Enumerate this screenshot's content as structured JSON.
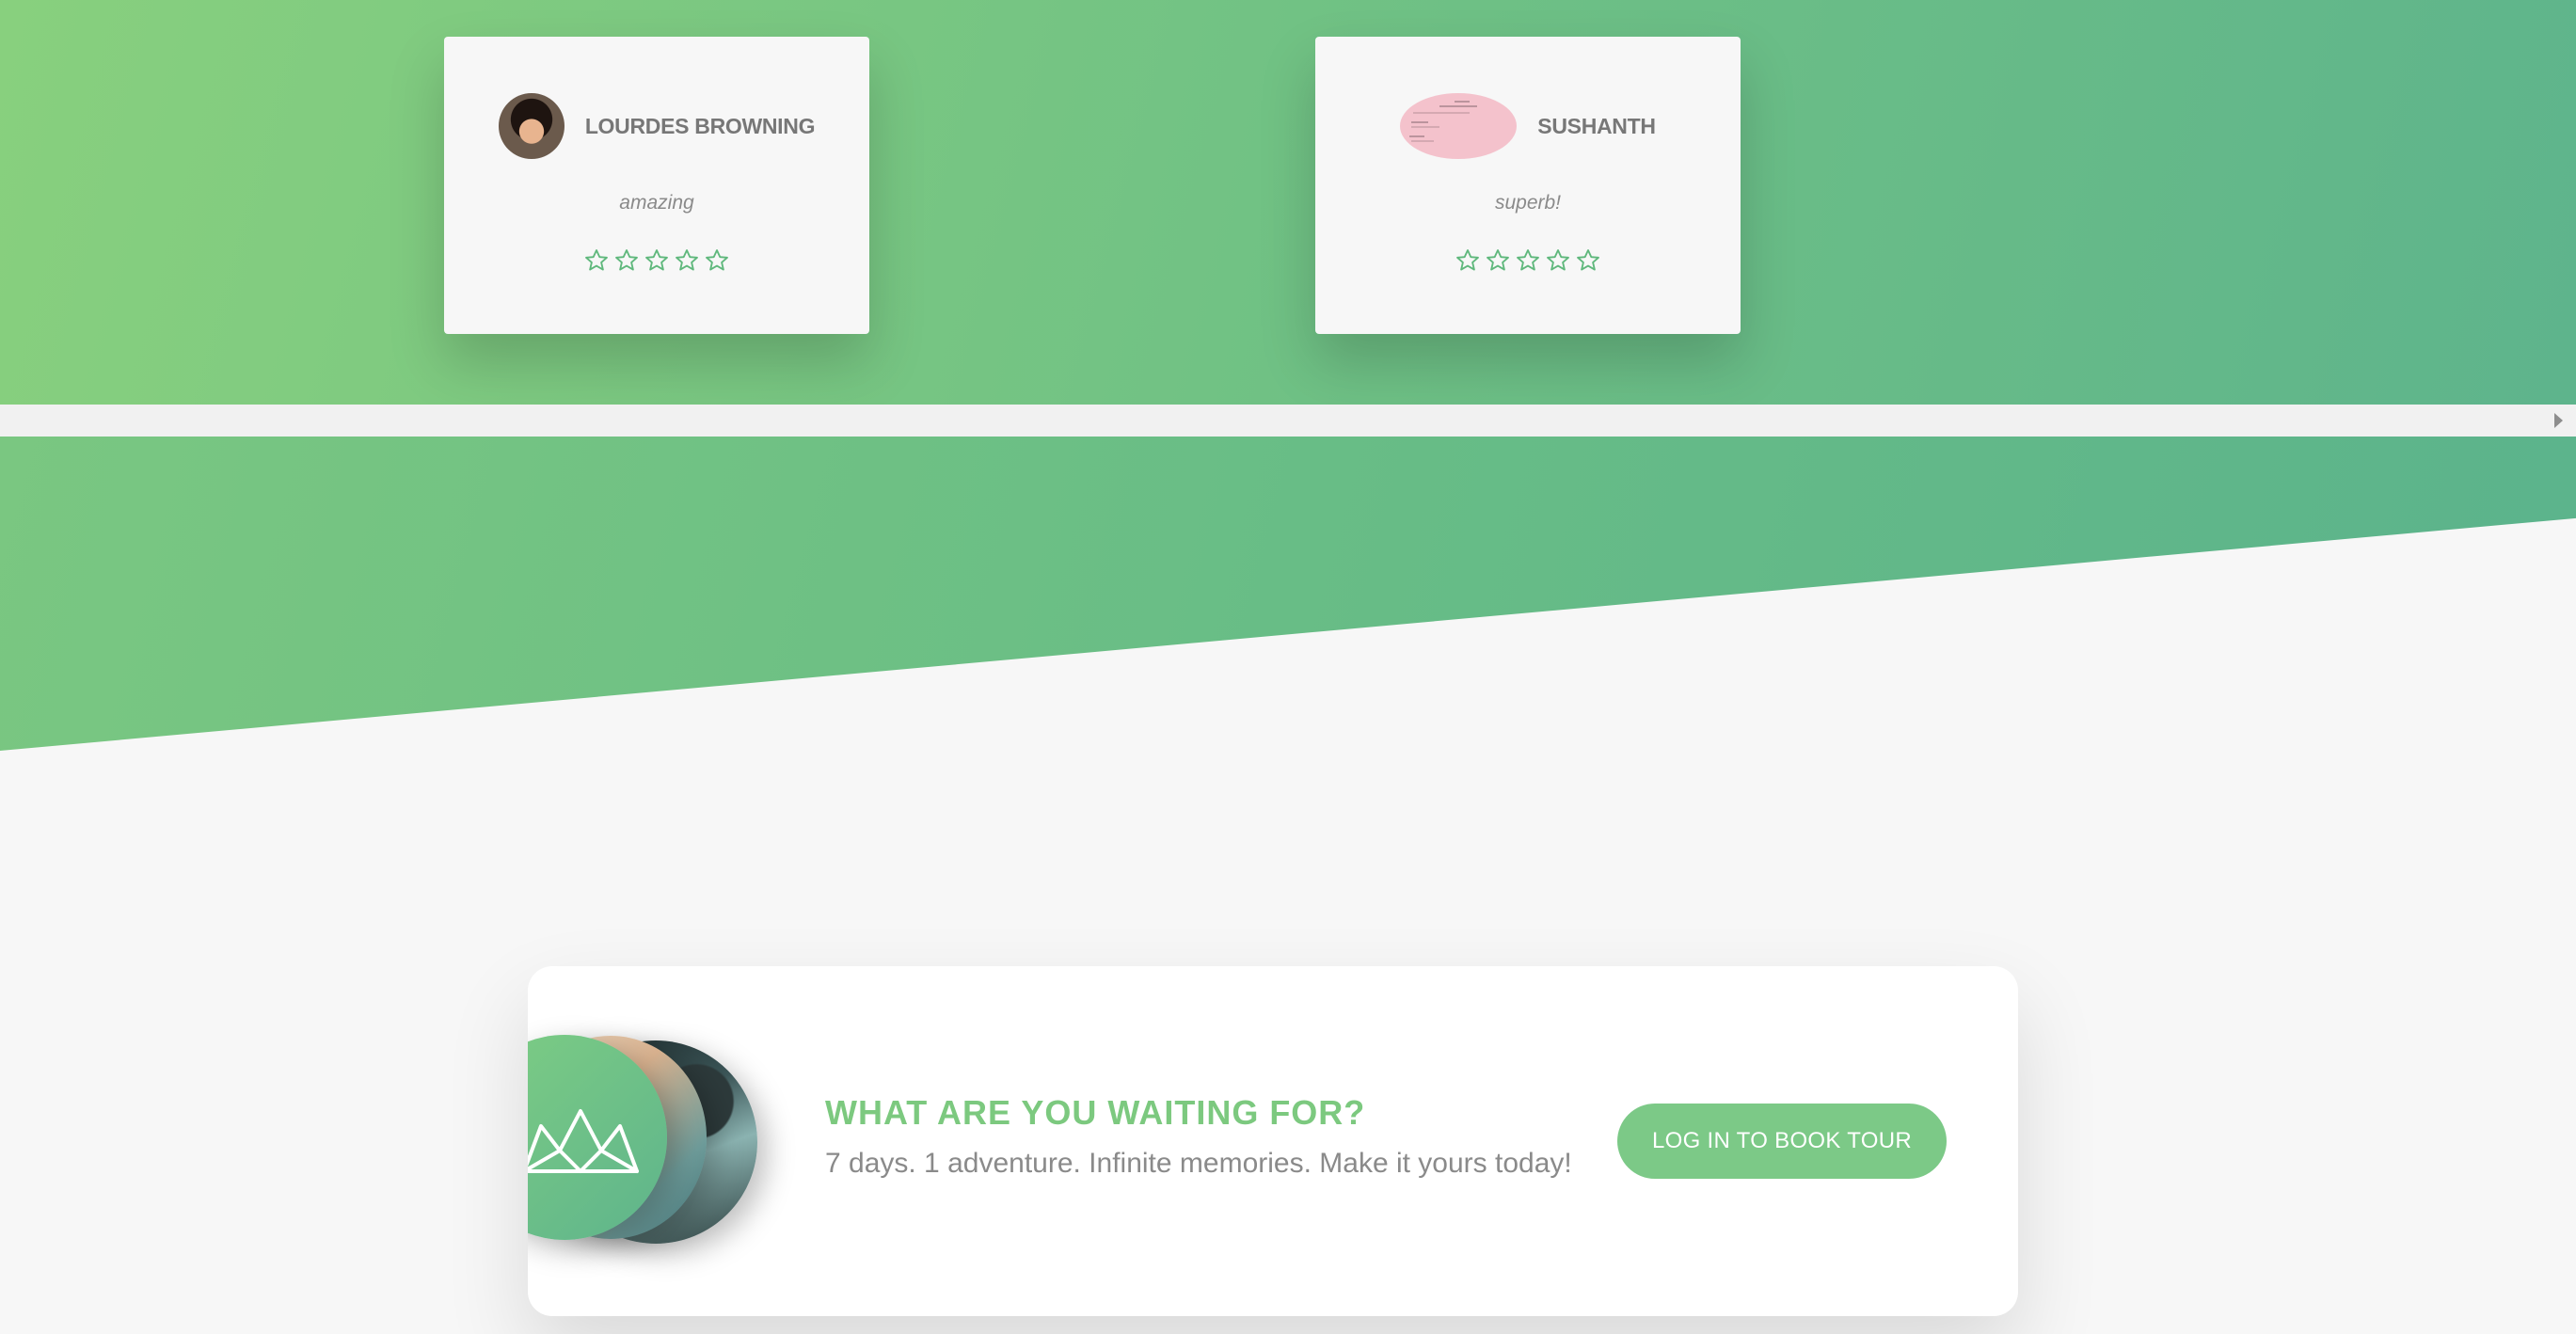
{
  "reviews": [
    {
      "user": "LOURDES BROWNING",
      "avatar": "user-photo",
      "text": "amazing",
      "rating": 0,
      "max_rating": 5
    },
    {
      "user": "SUSHANTH",
      "avatar": "user-photo-placeholder",
      "text": "superb!",
      "rating": 0,
      "max_rating": 5
    }
  ],
  "scrollbar": {
    "arrow_icon": "scroll-right-arrow-icon"
  },
  "cta": {
    "logo_icon": "crown-logo-icon",
    "heading": "WHAT ARE YOU WAITING FOR?",
    "text": "7 days. 1 adventure. Infinite memories. Make it yours today!",
    "button_label": "LOG IN TO BOOK TOUR"
  },
  "colors": {
    "brand_green": "#7cc97f",
    "brand_green_dark": "#5eb48c",
    "card_background": "#f7f7f7",
    "star_outline": "#5fb87c"
  }
}
